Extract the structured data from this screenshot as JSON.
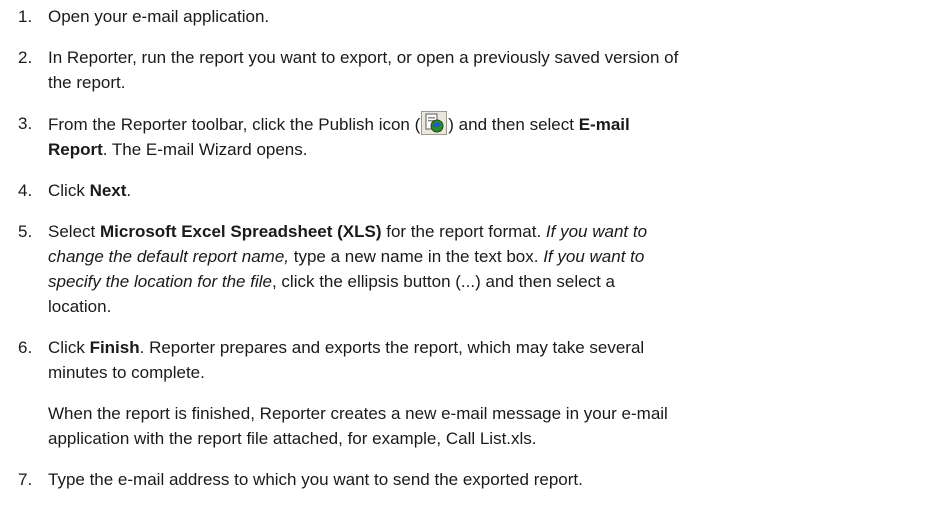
{
  "steps": [
    {
      "number": "1.",
      "lines": [
        [
          "Open your e-mail application."
        ]
      ]
    },
    {
      "number": "2.",
      "lines": [
        [
          "In Reporter, run the report you want to export, or open a previously saved version of"
        ],
        [
          "the report."
        ]
      ]
    },
    {
      "number": "3.",
      "line1_a": "From the Reporter toolbar, click the Publish icon (",
      "line1_b": ") and then select ",
      "line1_bold": "E-mail",
      "line2_bold": "Report",
      "line2_rest": ". The E-mail Wizard opens."
    },
    {
      "number": "4.",
      "a": "Click ",
      "bold": "Next",
      "b": "."
    },
    {
      "number": "5.",
      "l1_a": "Select ",
      "l1_bold": "Microsoft Excel Spreadsheet (XLS)",
      "l1_b": " for the report format. ",
      "l1_italic": "If you want to",
      "l2_italic": "change the default report name,",
      "l2_a": " type a new name in the text box. ",
      "l2_italic2": "If you want to",
      "l3_italic": "specify the location for the file",
      "l3_a": ", click the ellipsis button (...) and then select a",
      "l4": "location."
    },
    {
      "number": "6.",
      "l1_a": "Click ",
      "l1_bold": "Finish",
      "l1_b": ". Reporter prepares and exports the report, which may take several",
      "l2": "minutes to complete."
    },
    {
      "number": "7.",
      "l1": "Type the e-mail address to which you want to send the exported report."
    }
  ],
  "note": {
    "l1": "When the report is finished, Reporter creates a new e-mail message in your e-mail",
    "l2": "application with the report file attached, for example, Call List.xls."
  },
  "icons": {
    "publish": "publish-icon"
  }
}
